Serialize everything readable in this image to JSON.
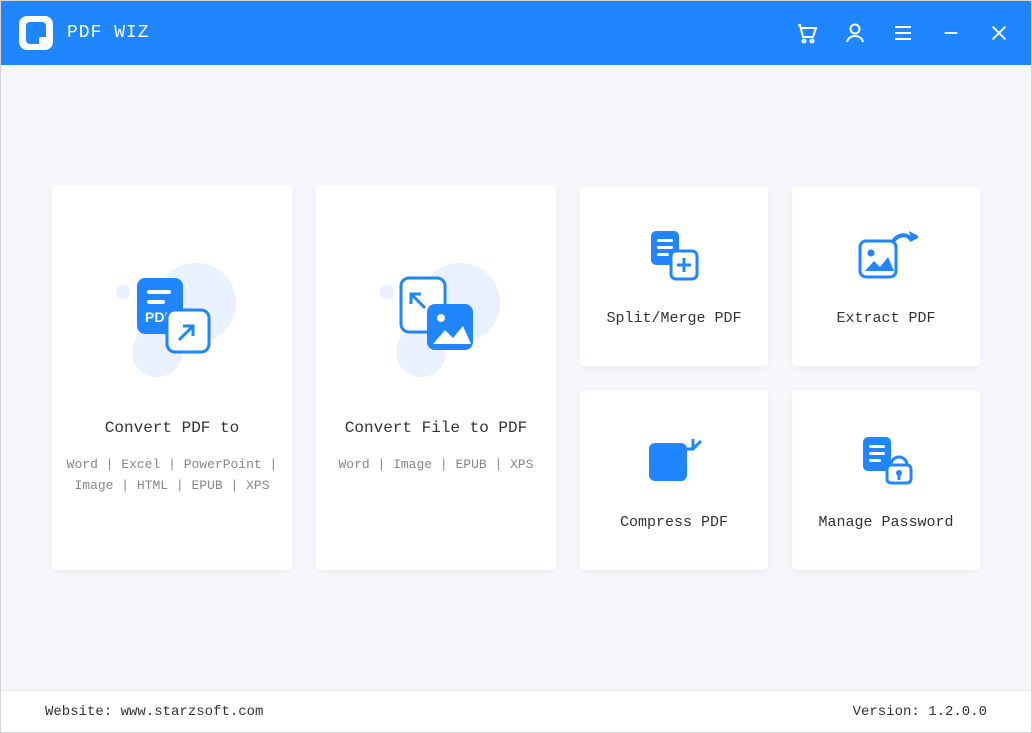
{
  "app": {
    "title": "PDF WIZ"
  },
  "cards": {
    "convert_pdf_to": {
      "title": "Convert PDF to",
      "subtitle": "Word | Excel | PowerPoint | Image | HTML | EPUB | XPS"
    },
    "convert_file_to_pdf": {
      "title": "Convert File to PDF",
      "subtitle": "Word | Image | EPUB | XPS"
    },
    "split_merge": {
      "title": "Split/Merge PDF"
    },
    "extract": {
      "title": "Extract PDF"
    },
    "compress": {
      "title": "Compress PDF"
    },
    "manage_password": {
      "title": "Manage Password"
    }
  },
  "footer": {
    "website_label": "Website: ",
    "website_url": "www.starzsoft.com",
    "version_label": "Version: ",
    "version": "1.2.0.0"
  },
  "colors": {
    "primary": "#1f86ff",
    "primary_dark": "#1564d6",
    "card_bg": "#ffffff",
    "page_bg": "#f5f7fa",
    "blob": "#e9f1ff"
  }
}
